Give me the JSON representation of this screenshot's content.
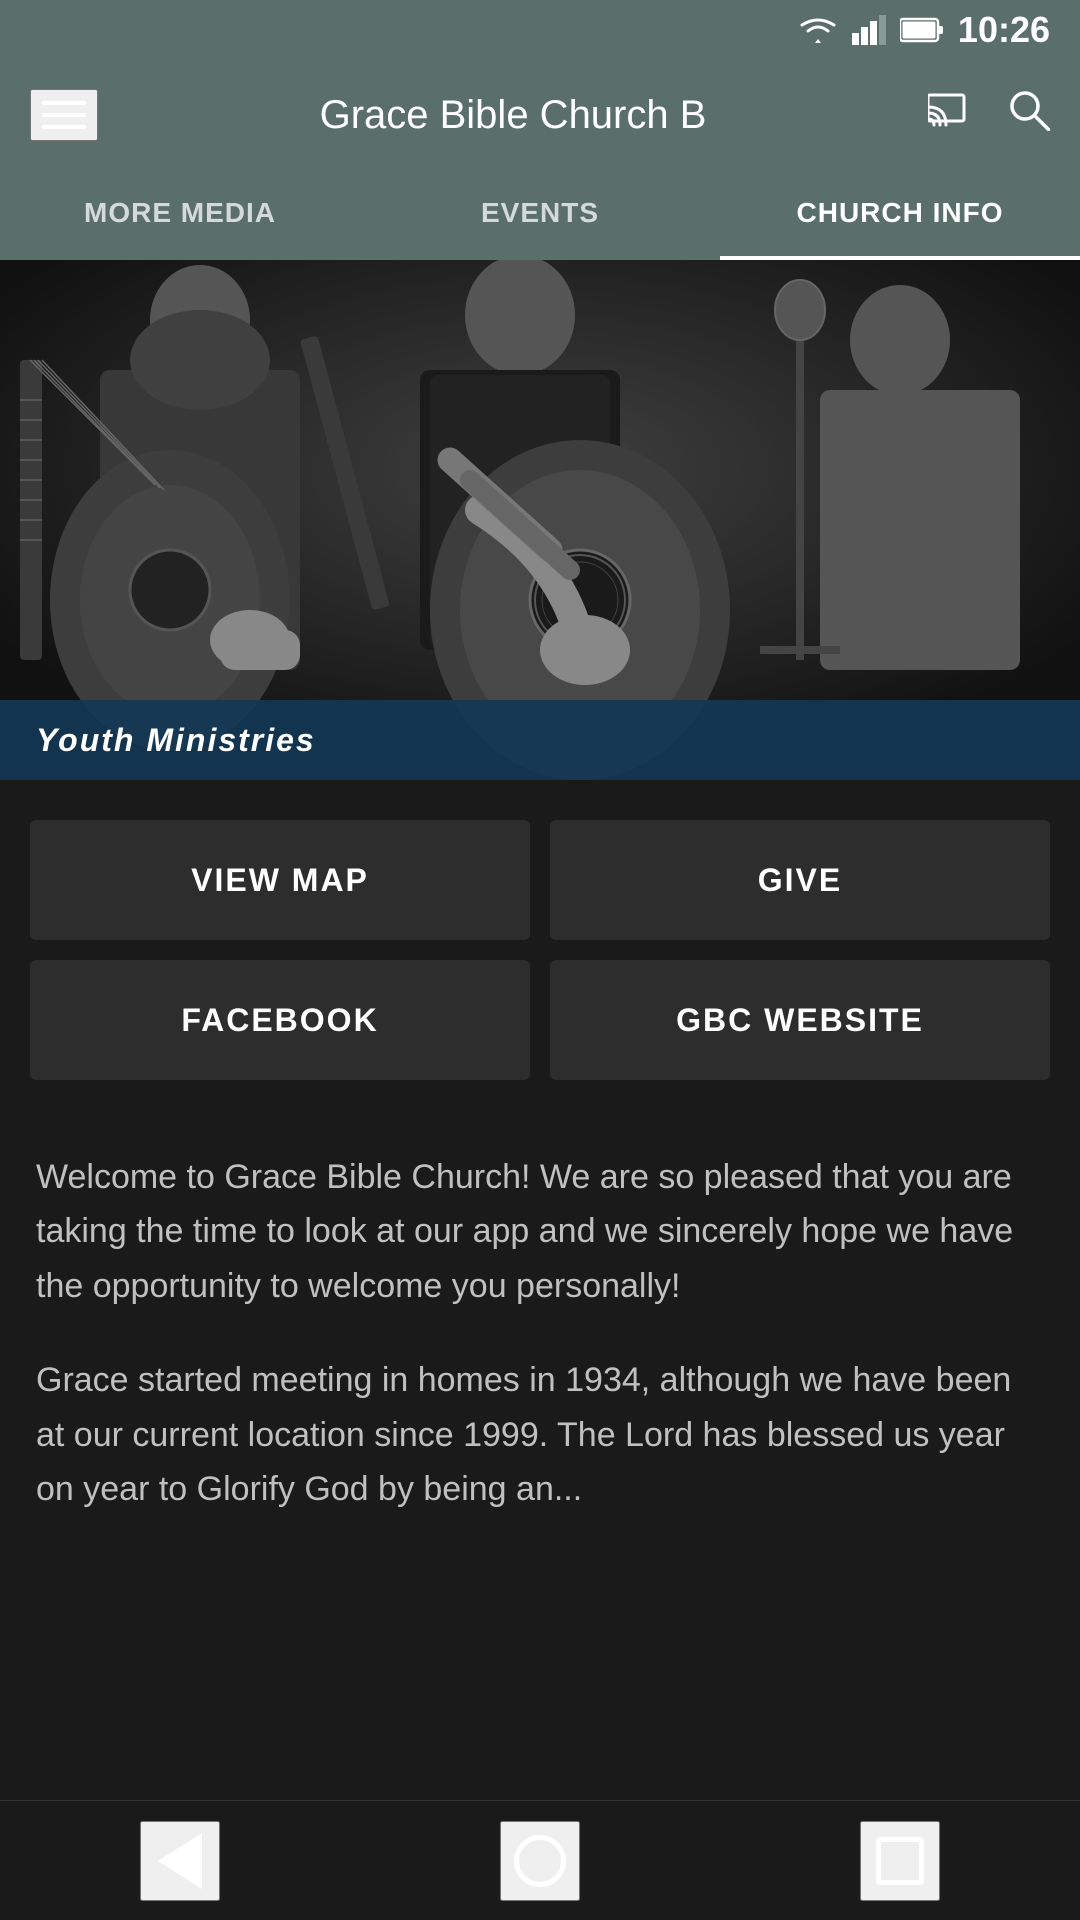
{
  "statusBar": {
    "time": "10:26"
  },
  "topNav": {
    "title": "Grace Bible Church B",
    "hamburgerLabel": "menu",
    "castLabel": "cast",
    "searchLabel": "search"
  },
  "tabs": [
    {
      "id": "more-media",
      "label": "MORE MEDIA",
      "active": false
    },
    {
      "id": "events",
      "label": "EVENTS",
      "active": false
    },
    {
      "id": "church-info",
      "label": "CHURCH INFO",
      "active": true
    }
  ],
  "hero": {
    "bannerText": "Youth Ministries"
  },
  "buttons": [
    {
      "id": "view-map",
      "label": "VIEW MAP"
    },
    {
      "id": "give",
      "label": "GIVE"
    },
    {
      "id": "facebook",
      "label": "FACEBOOK"
    },
    {
      "id": "gbc-website",
      "label": "GBC WEBSITE"
    }
  ],
  "content": {
    "paragraph1": "Welcome to Grace Bible Church!  We are so pleased that you are taking the time to look at our app and we sincerely hope we have the opportunity to welcome you personally!",
    "paragraph2": "Grace started meeting in homes in 1934, although we have been at our current location since 1999.  The Lord has blessed us year on year to Glorify God by being an..."
  },
  "bottomNav": {
    "back": "back",
    "home": "home",
    "recents": "recents"
  },
  "colors": {
    "navBg": "#5a6e6a",
    "contentBg": "#1a1a1a",
    "buttonBg": "#2d2d2d",
    "bannerBg": "#1a3755",
    "activeTab": "#ffffff",
    "textLight": "#c0c0c0"
  }
}
